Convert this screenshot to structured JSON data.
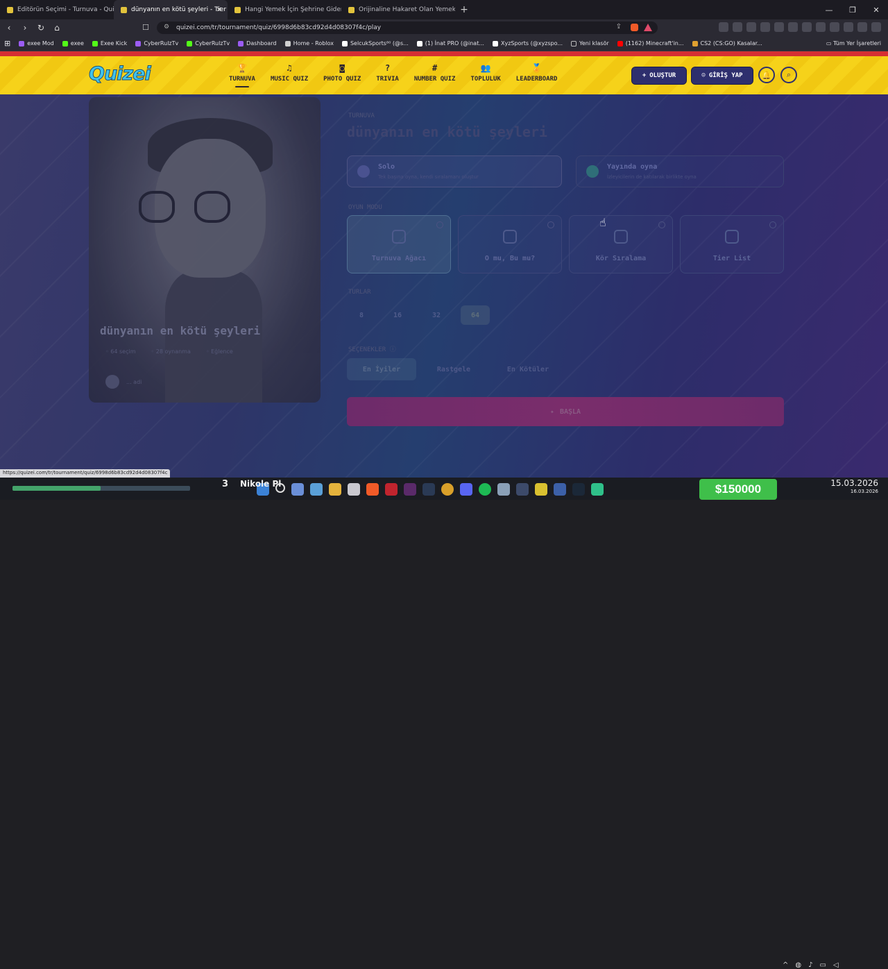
{
  "browser": {
    "tabs": [
      {
        "title": "Editörün Seçimi - Turnuva - Quizei",
        "active": false
      },
      {
        "title": "dünyanın en kötü şeyleri - Tier Li",
        "active": true
      },
      {
        "title": "Hangi Yemek İçin Şehrine Gidersin?",
        "active": false
      },
      {
        "title": "Orijinaline Hakaret Olan Yemek - Tier",
        "active": false
      }
    ],
    "new_tab": "+",
    "url": "quizei.com/tr/tournament/quiz/6998d6b83cd92d4d08307f4c/play",
    "bookmarks": [
      {
        "label": "exee Mod",
        "color": "#9b5cf5"
      },
      {
        "label": "exee",
        "color": "#53fc18"
      },
      {
        "label": "Exee Kick",
        "color": "#53fc18"
      },
      {
        "label": "CyberRulzTv",
        "color": "#9b5cf5"
      },
      {
        "label": "CyberRulzTv",
        "color": "#53fc18"
      },
      {
        "label": "Dashboard",
        "color": "#9b5cf5"
      },
      {
        "label": "Home - Roblox",
        "color": "#cfcfcf"
      },
      {
        "label": "SelcukSports⁸⁰ (@s...",
        "color": "#ffffff"
      },
      {
        "label": "(1) İnat PRO (@inat...",
        "color": "#ffffff"
      },
      {
        "label": "XyzSports (@xyzspo...",
        "color": "#ffffff"
      },
      {
        "label": "Yeni klasör",
        "color": "#bbbbbb"
      },
      {
        "label": "(1162) Minecraft'in...",
        "color": "#ff0000"
      },
      {
        "label": "CS2 (CS:GO) Kasalar...",
        "color": "#e0a030"
      }
    ],
    "all_bookmarks": "Tüm Yer İşaretleri",
    "status_url": "https://quizei.com/tr/tournament/quiz/6998d6b83cd92d4d08307f4c"
  },
  "site": {
    "logo": "Quizei",
    "menu": [
      {
        "icon": "🏆",
        "label": "TURNUVA",
        "active": true
      },
      {
        "icon": "♫",
        "label": "MUSIC QUIZ"
      },
      {
        "icon": "◙",
        "label": "PHOTO QUIZ"
      },
      {
        "icon": "?",
        "label": "TRIVIA"
      },
      {
        "icon": "#",
        "label": "NUMBER QUIZ"
      },
      {
        "icon": "👥",
        "label": "TOPLULUK"
      },
      {
        "icon": "🏅",
        "label": "LEADERBOARD"
      }
    ],
    "create_label": "OLUŞTUR",
    "login_label": "GİRİŞ YAP"
  },
  "quiz": {
    "breadcrumb": "TURNUVA",
    "title": "dünyanın en kötü şeyleri",
    "cover_title": "dünyanın en kötü şeyleri",
    "cover_meta": [
      "64 seçim",
      "28 oynanma",
      "Eğlence"
    ],
    "cover_user": "... adi",
    "modes": [
      {
        "title": "Solo",
        "subtitle": "Tek başına oyna, kendi sıralamanı oluştur"
      },
      {
        "title": "Yayında oyna",
        "subtitle": "İzleyicilerin de katılarak birlikte oyna"
      }
    ],
    "game_mode_label": "OYUN MODU",
    "game_modes": [
      {
        "label": "Turnuva Ağacı",
        "selected": true
      },
      {
        "label": "O mu, Bu mu?",
        "selected": false
      },
      {
        "label": "Kör Sıralama",
        "selected": false
      },
      {
        "label": "Tier List",
        "selected": false
      }
    ],
    "round_label": "TURLAR",
    "rounds": [
      {
        "label": "8",
        "selected": false
      },
      {
        "label": "16",
        "selected": false
      },
      {
        "label": "32",
        "selected": false
      },
      {
        "label": "64",
        "selected": true
      }
    ],
    "sort_label": "SEÇENEKLER",
    "sort_options": [
      {
        "label": "En İyiler",
        "selected": true
      },
      {
        "label": "Rastgele",
        "selected": false
      },
      {
        "label": "En Kötüler",
        "selected": false
      }
    ],
    "start_label": "BAŞLA"
  },
  "taskbar": {
    "number": "3",
    "window_title": "Nikole Pl",
    "money": "$150000",
    "time": "15.03.2026",
    "date": "16.03.2026"
  }
}
